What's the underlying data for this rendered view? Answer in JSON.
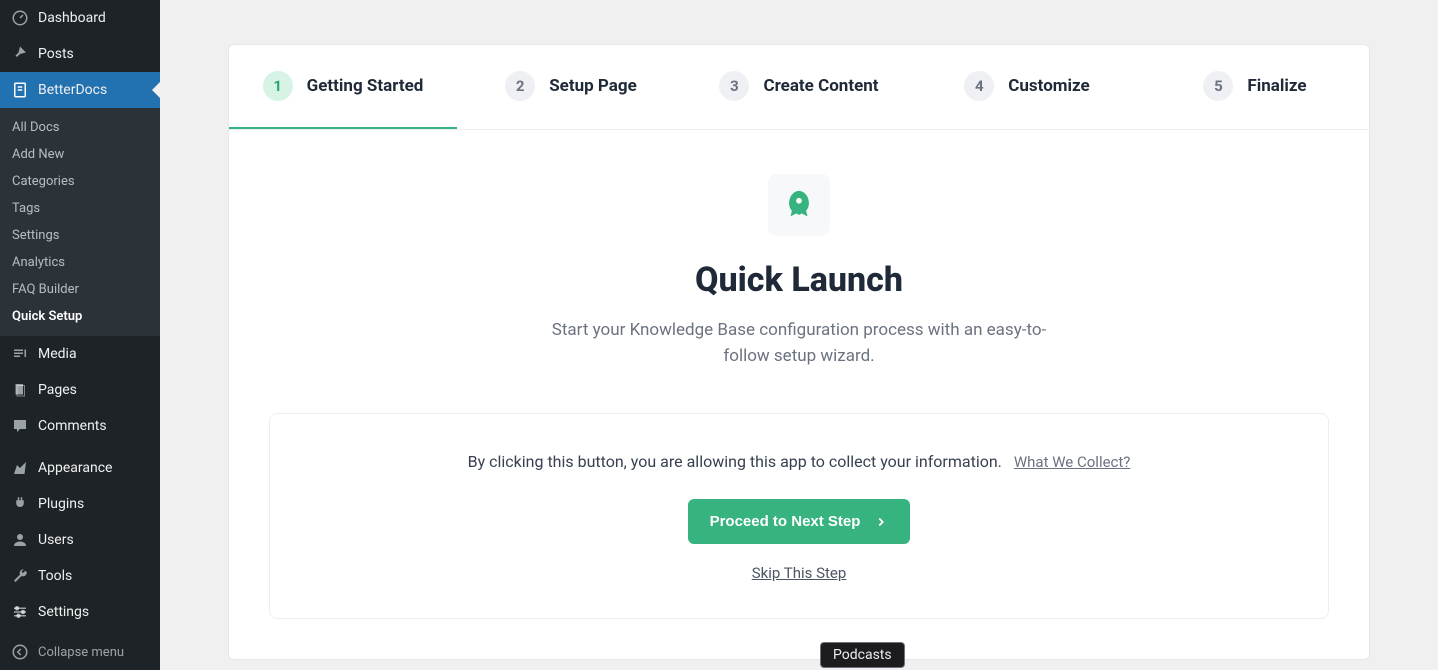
{
  "sidebar": {
    "main_items": [
      {
        "name": "dashboard",
        "label": "Dashboard",
        "icon": "dashboard"
      },
      {
        "name": "posts",
        "label": "Posts",
        "icon": "pin"
      },
      {
        "name": "betterdocs",
        "label": "BetterDocs",
        "icon": "docs",
        "active": true
      }
    ],
    "submenu": [
      {
        "name": "all-docs",
        "label": "All Docs"
      },
      {
        "name": "add-new",
        "label": "Add New"
      },
      {
        "name": "categories",
        "label": "Categories"
      },
      {
        "name": "tags",
        "label": "Tags"
      },
      {
        "name": "settings",
        "label": "Settings"
      },
      {
        "name": "analytics",
        "label": "Analytics"
      },
      {
        "name": "faq-builder",
        "label": "FAQ Builder"
      },
      {
        "name": "quick-setup",
        "label": "Quick Setup",
        "current": true
      }
    ],
    "lower_items": [
      {
        "name": "media",
        "label": "Media",
        "icon": "media"
      },
      {
        "name": "pages",
        "label": "Pages",
        "icon": "pages"
      },
      {
        "name": "comments",
        "label": "Comments",
        "icon": "comments"
      },
      {
        "name": "appearance",
        "label": "Appearance",
        "icon": "appearance",
        "sep": true
      },
      {
        "name": "plugins",
        "label": "Plugins",
        "icon": "plugins"
      },
      {
        "name": "users",
        "label": "Users",
        "icon": "users"
      },
      {
        "name": "tools",
        "label": "Tools",
        "icon": "tools"
      },
      {
        "name": "admin-settings",
        "label": "Settings",
        "icon": "sliders"
      }
    ],
    "collapse_label": "Collapse menu"
  },
  "steps": [
    {
      "num": "1",
      "label": "Getting Started",
      "active": true
    },
    {
      "num": "2",
      "label": "Setup Page"
    },
    {
      "num": "3",
      "label": "Create Content"
    },
    {
      "num": "4",
      "label": "Customize"
    },
    {
      "num": "5",
      "label": "Finalize"
    }
  ],
  "wizard": {
    "title": "Quick Launch",
    "subtitle": "Start your Knowledge Base configuration process with an easy-to-follow setup wizard.",
    "consent_text": "By clicking this button, you are allowing this app to collect your information.",
    "consent_link": "What We Collect?",
    "proceed_label": "Proceed to Next Step",
    "skip_label": "Skip This Step"
  },
  "tooltip": {
    "podcasts": "Podcasts"
  }
}
